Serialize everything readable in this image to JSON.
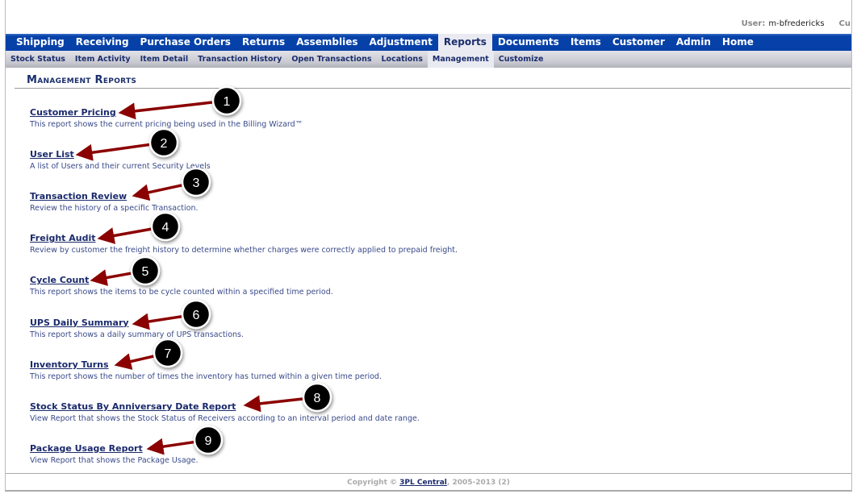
{
  "user": {
    "label": "User:",
    "name": "m-bfredericks",
    "truncated": "Cu"
  },
  "top_nav": [
    "Shipping",
    "Receiving",
    "Purchase Orders",
    "Returns",
    "Assemblies",
    "Adjustment",
    "Reports",
    "Documents",
    "Items",
    "Customer",
    "Admin",
    "Home"
  ],
  "top_nav_active": "Reports",
  "sub_nav": [
    "Stock Status",
    "Item Activity",
    "Item Detail",
    "Transaction History",
    "Open Transactions",
    "Locations",
    "Management",
    "Customize"
  ],
  "sub_nav_active": "Management",
  "page_title": "Management Reports",
  "reports": [
    {
      "title": "Customer Pricing",
      "desc": "This report shows the current pricing being used in the Billing Wizard™",
      "callout": "1"
    },
    {
      "title": "User List",
      "desc": "A list of Users and their current Security Levels",
      "callout": "2"
    },
    {
      "title": "Transaction Review",
      "desc": "Review the history of a specific Transaction.",
      "callout": "3"
    },
    {
      "title": "Freight Audit",
      "desc": "Review by customer the freight history to determine whether charges were correctly applied to prepaid freight.",
      "callout": "4"
    },
    {
      "title": "Cycle Count",
      "desc": "This report shows the items to be cycle counted within a specified time period.",
      "callout": "5"
    },
    {
      "title": "UPS Daily Summary",
      "desc": "This report shows a daily summary of UPS transactions.",
      "callout": "6"
    },
    {
      "title": "Inventory Turns",
      "desc": "This report shows the number of times the inventory has turned within a given time period.",
      "callout": "7"
    },
    {
      "title": "Stock Status By Anniversary Date Report",
      "desc": "View Report that shows the Stock Status of Receivers according to an interval period and date range.",
      "callout": "8"
    },
    {
      "title": "Package Usage Report",
      "desc": "View Report that shows the Package Usage.",
      "callout": "9"
    }
  ],
  "footer": {
    "prefix": "Copyright © ",
    "link": "3PL Central",
    "suffix": ", 2005-2013 (2)"
  },
  "colors": {
    "nav_blue": "#0540a8",
    "link": "#1a2a6c",
    "arrow": "#8b0000",
    "callout": "#000000"
  }
}
